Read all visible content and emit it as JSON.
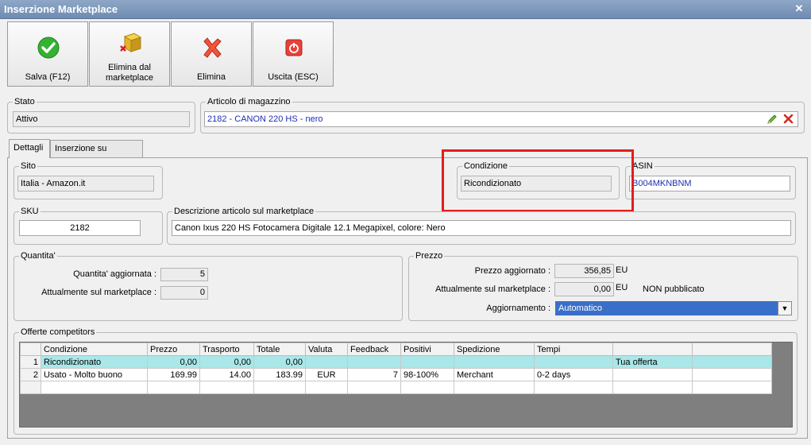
{
  "window": {
    "title": "Inserzione Marketplace"
  },
  "toolbar": {
    "save": "Salva (F12)",
    "remove_marketplace_line1": "Elimina dal",
    "remove_marketplace_line2": "marketplace",
    "delete": "Elimina",
    "exit": "Uscita (ESC)"
  },
  "stato": {
    "legend": "Stato",
    "value": "Attivo"
  },
  "articolo": {
    "legend": "Articolo di magazzino",
    "value": "2182 - CANON 220 HS - nero"
  },
  "tabs": [
    {
      "label": "Dettagli"
    },
    {
      "label": "Inserzione su Amazon"
    }
  ],
  "sito": {
    "legend": "Sito",
    "value": "Italia - Amazon.it"
  },
  "condizione": {
    "legend": "Condizione",
    "value": "Ricondizionato"
  },
  "asin": {
    "legend": "ASIN",
    "value": "B004MKNBNM"
  },
  "sku": {
    "legend": "SKU",
    "value": "2182"
  },
  "descrizione": {
    "legend": "Descrizione articolo sul marketplace",
    "value": "Canon Ixus 220 HS Fotocamera Digitale 12.1 Megapixel, colore: Nero"
  },
  "quantita": {
    "legend": "Quantita'",
    "updated_label": "Quantita' aggiornata :",
    "updated_value": "5",
    "current_label": "Attualmente sul marketplace :",
    "current_value": "0"
  },
  "prezzo": {
    "legend": "Prezzo",
    "updated_label": "Prezzo aggiornato :",
    "updated_value": "356,85",
    "updated_unit": "EU",
    "current_label": "Attualmente sul marketplace :",
    "current_value": "0,00",
    "current_unit": "EU",
    "status": "NON pubblicato",
    "update_label": "Aggiornamento :",
    "update_value": "Automatico"
  },
  "offerte": {
    "legend": "Offerte competitors",
    "columns": [
      "Condizione",
      "Prezzo",
      "Trasporto",
      "Totale",
      "Valuta",
      "Feedback",
      "Positivi",
      "Spedizione",
      "Tempi",
      "",
      ""
    ],
    "rows": [
      {
        "n": "1",
        "cells": [
          "Ricondizionato",
          "0,00",
          "0,00",
          "0,00",
          "",
          "",
          "",
          "",
          "",
          "Tua offerta",
          ""
        ]
      },
      {
        "n": "2",
        "cells": [
          "Usato - Molto buono",
          "169.99",
          "14.00",
          "183.99",
          "EUR",
          "7",
          "98-100%",
          "Merchant",
          "0-2 days",
          "",
          ""
        ]
      }
    ]
  }
}
